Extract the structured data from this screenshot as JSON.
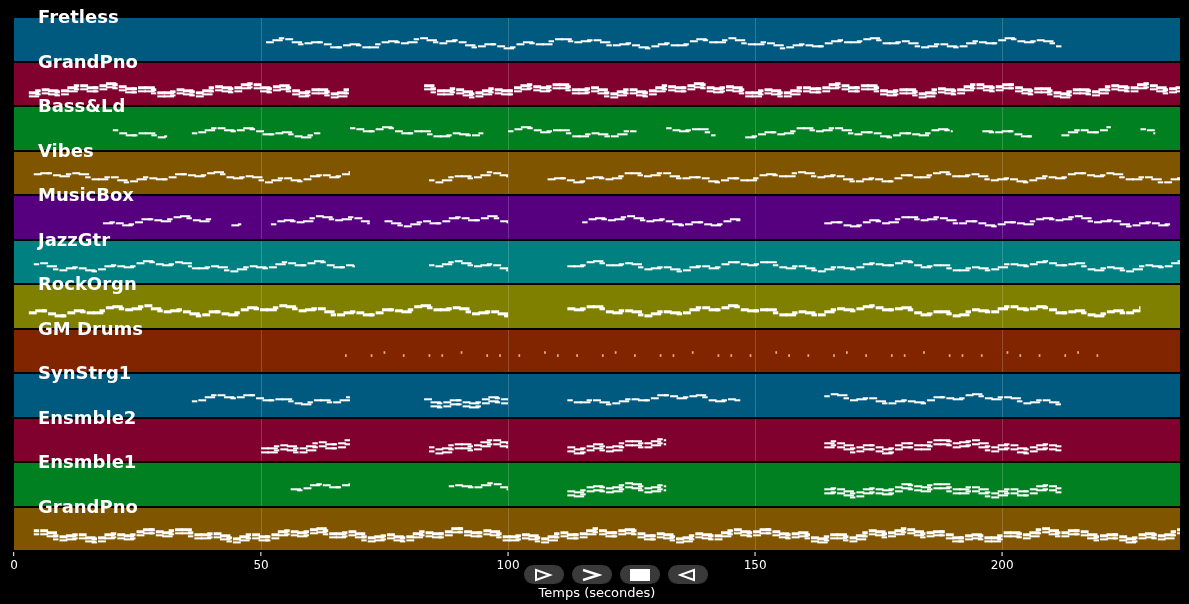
{
  "tracks": [
    {
      "name": "Fretless",
      "color": "#005a80"
    },
    {
      "name": "GrandPno",
      "color": "#80002e"
    },
    {
      "name": "Bass&Ld",
      "color": "#008020"
    },
    {
      "name": "Vibes",
      "color": "#805500"
    },
    {
      "name": "MusicBox",
      "color": "#560080"
    },
    {
      "name": "JazzGtr",
      "color": "#008080"
    },
    {
      "name": "RockOrgn",
      "color": "#808000"
    },
    {
      "name": "GM Drums",
      "color": "#802500"
    },
    {
      "name": "SynStrg1",
      "color": "#005a80"
    },
    {
      "name": "Ensmble2",
      "color": "#80002e"
    },
    {
      "name": "Ensmble1",
      "color": "#008020"
    },
    {
      "name": "GrandPno",
      "color": "#805500"
    }
  ],
  "x_axis": {
    "ticks": [
      "0",
      "50",
      "100",
      "150",
      "200"
    ],
    "label": "Temps (secondes)"
  }
}
